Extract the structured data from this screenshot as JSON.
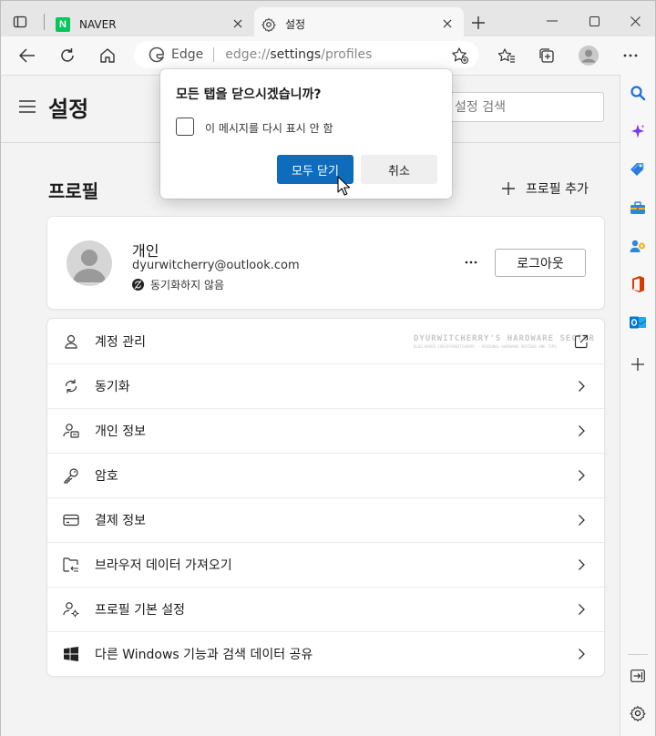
{
  "tabs": [
    {
      "title": "NAVER",
      "favicon": "naver-icon",
      "active": false
    },
    {
      "title": "설정",
      "favicon": "gear-icon",
      "active": true
    }
  ],
  "omnibox": {
    "site_label": "Edge",
    "url_prefix": "edge://",
    "url_bold": "settings",
    "url_suffix": "/profiles"
  },
  "settings": {
    "page_title": "설정",
    "search_placeholder": "설정 검색",
    "section_title": "프로필",
    "add_profile_label": "프로필 추가"
  },
  "profile": {
    "name": "개인",
    "email": "dyurwitcherry@outlook.com",
    "sync_status": "동기화하지 않음",
    "logout_label": "로그아웃"
  },
  "list_items": [
    {
      "label": "계정 관리",
      "icon": "person-icon",
      "trailing": "external-link-icon"
    },
    {
      "label": "동기화",
      "icon": "sync-icon",
      "trailing": "chevron-right-icon"
    },
    {
      "label": "개인 정보",
      "icon": "personal-info-icon",
      "trailing": "chevron-right-icon"
    },
    {
      "label": "암호",
      "icon": "key-icon",
      "trailing": "chevron-right-icon"
    },
    {
      "label": "결제 정보",
      "icon": "card-icon",
      "trailing": "chevron-right-icon"
    },
    {
      "label": "브라우저 데이터 가져오기",
      "icon": "import-icon",
      "trailing": "chevron-right-icon"
    },
    {
      "label": "프로필 기본 설정",
      "icon": "profile-settings-icon",
      "trailing": "chevron-right-icon"
    },
    {
      "label": "다른 Windows 기능과 검색 데이터 공유",
      "icon": "windows-icon",
      "trailing": "chevron-right-icon"
    }
  ],
  "watermark": {
    "text": "DYURWITCHERRY'S HARDWARE SECTOR",
    "subtext": "BLOG.NAVER.COM/DYURWITCHERRY · PERSONAL HARDWARE REVIEWS AND TIPS"
  },
  "dialog": {
    "title": "모든 탭을 닫으시겠습니까?",
    "checkbox_label": "이 메시지를 다시 표시 안 함",
    "checkbox_checked": false,
    "primary_label": "모두 닫기",
    "secondary_label": "취소"
  },
  "sidebar_icons": [
    "search-icon",
    "copilot-icon",
    "shopping-tag-icon",
    "tools-icon",
    "games-icon",
    "office-icon",
    "outlook-icon",
    "add-icon",
    "hide-sidebar-icon",
    "settings-icon"
  ],
  "colors": {
    "accent": "#0f6cbd",
    "naver": "#03c75a",
    "office": "#d83b01",
    "outlook": "#0078d4"
  }
}
